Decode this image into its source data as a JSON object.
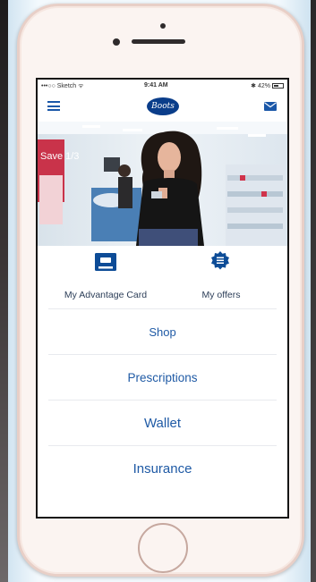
{
  "status_bar": {
    "carrier": "•••○○ Sketch ᯤ",
    "time": "9:41 AM",
    "battery": "✱ 42%"
  },
  "header": {
    "logo_text": "Boots"
  },
  "hero": {
    "store_sign": "Save 1/3"
  },
  "quick_links": [
    {
      "label": "My Advantage Card"
    },
    {
      "label": "My offers"
    }
  ],
  "menu": [
    {
      "label": "Shop"
    },
    {
      "label": "Prescriptions"
    },
    {
      "label": "Wallet"
    },
    {
      "label": "Insurance"
    }
  ],
  "colors": {
    "accent": "#1f5aa5",
    "brand": "#0a3d8a"
  }
}
